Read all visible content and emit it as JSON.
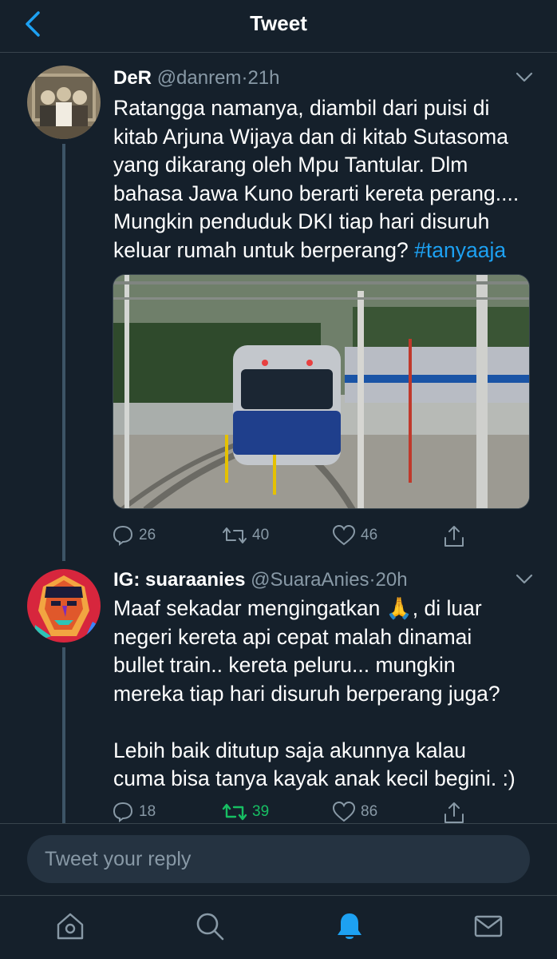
{
  "header": {
    "title": "Tweet"
  },
  "tweets": [
    {
      "name": "DeR",
      "handle": "@danrem",
      "separator": "·",
      "time": "21h",
      "text_lines": [
        "Ratangga namanya, diambil dari puisi di",
        "kitab Arjuna Wijaya dan di kitab Sutasoma",
        "yang dikarang oleh Mpu Tantular. Dlm",
        "bahasa Jawa Kuno berarti kereta perang....",
        "Mungkin penduduk DKI tiap hari disuruh",
        "keluar rumah untuk berperang?"
      ],
      "hashtag": "#tanyaaja",
      "replies": "26",
      "retweets": "40",
      "likes": "46"
    },
    {
      "name": "IG: suaraanies",
      "handle": "@SuaraAnies",
      "separator": "·",
      "time": "20h",
      "text_lines": [
        "Maaf sekadar mengingatkan 🙏, di luar",
        "negeri kereta api cepat malah dinamai",
        "bullet train.. kereta peluru... mungkin",
        "mereka tiap hari disuruh berperang juga?",
        "",
        "Lebih baik ditutup saja akunnya kalau",
        "cuma bisa tanya kayak anak kecil begini. :)"
      ],
      "replies": "18",
      "retweets": "39",
      "likes": "86"
    }
  ],
  "reply": {
    "placeholder": "Tweet your reply"
  },
  "colors": {
    "background": "#15202b",
    "accent": "#1da1f2",
    "muted": "#8899a6",
    "retweet_active": "#17bf63",
    "divider": "#38444d"
  },
  "tabbar": {
    "items": [
      "home-icon",
      "search-icon",
      "notifications-icon",
      "messages-icon"
    ],
    "active": "notifications-icon"
  }
}
